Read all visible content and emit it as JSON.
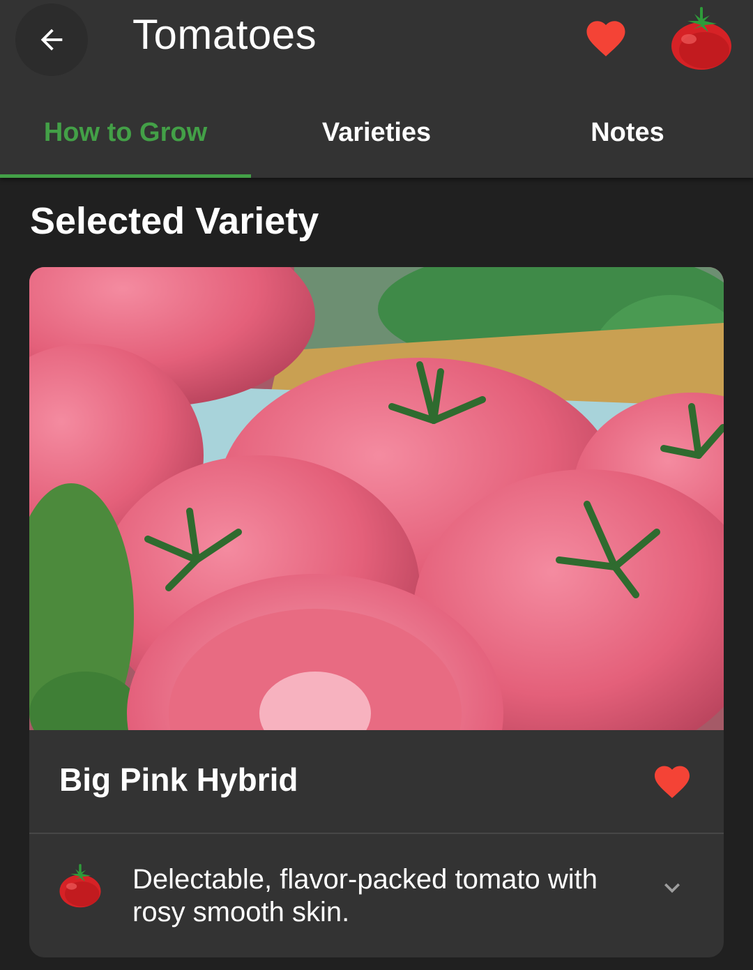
{
  "header": {
    "title": "Tomatoes",
    "back_icon": "arrow-back-icon",
    "favorite_icon": "heart-icon",
    "avatar_icon": "tomato-icon"
  },
  "tabs": [
    {
      "label": "How to Grow",
      "active": true
    },
    {
      "label": "Varieties",
      "active": false
    },
    {
      "label": "Notes",
      "active": false
    }
  ],
  "section_title": "Selected Variety",
  "variety": {
    "name": "Big Pink Hybrid",
    "favorite": true,
    "description": "Delectable, flavor-packed tomato with rosy smooth skin.",
    "photo": "pink tomatoes photo"
  },
  "colors": {
    "accent": "#43a047",
    "favorite": "#f44336",
    "app_bar": "#333333",
    "background": "#202020"
  }
}
